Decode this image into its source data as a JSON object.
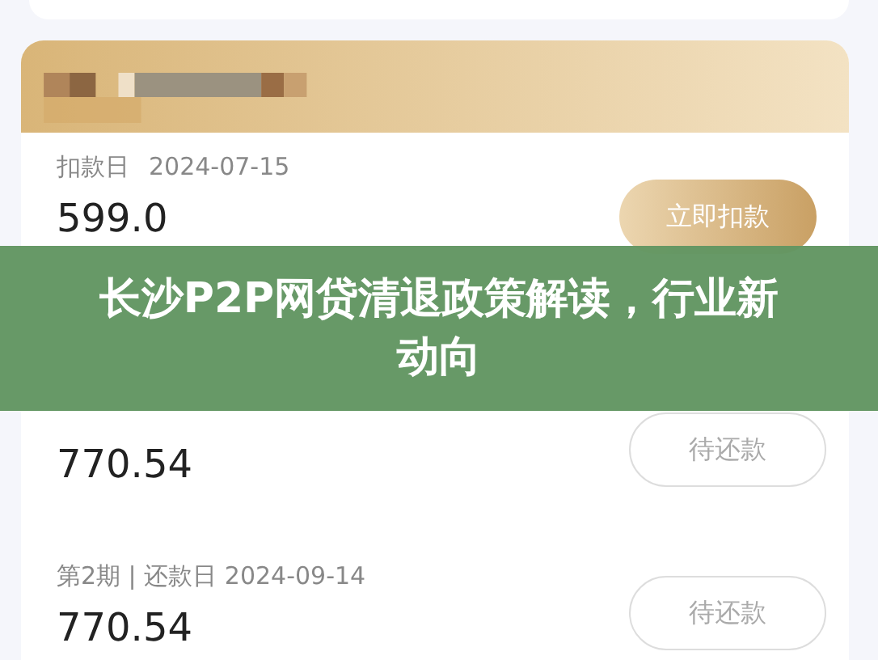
{
  "deduction": {
    "label": "扣款日",
    "date": "2024-07-15",
    "amount": "599.0",
    "button": {
      "label": "立即扣款",
      "kind": "primary"
    }
  },
  "installments": [
    {
      "amount": "770.54",
      "button": {
        "label": "待还款",
        "kind": "outline"
      }
    },
    {
      "header": "第2期 | 还款日 2024-09-14",
      "amount": "770.54",
      "button": {
        "label": "待还款",
        "kind": "outline"
      }
    }
  ],
  "banner": {
    "title": "长沙P2P网贷清退政策解读，行业新动向"
  }
}
